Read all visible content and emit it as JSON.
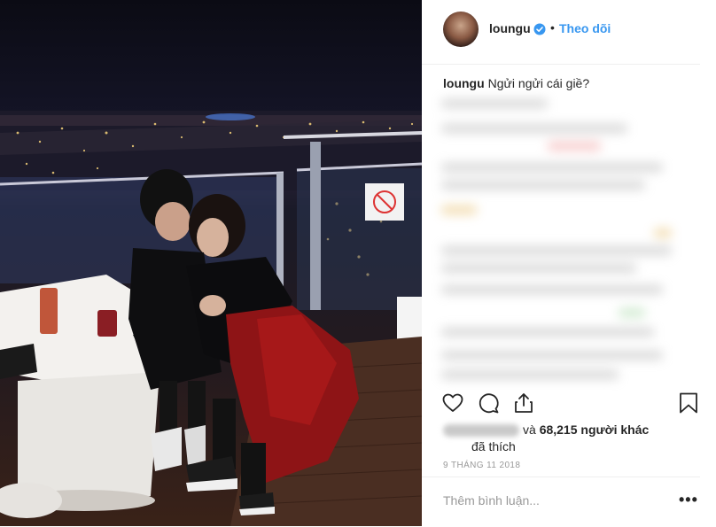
{
  "post": {
    "username": "loungu",
    "verified_icon": "verified-badge-icon",
    "separator": "•",
    "follow_label": "Theo dõi",
    "caption_user": "loungu",
    "caption_text": "Ngửi ngửi cái giề?",
    "likes_connector": "và",
    "likes_count": "68,215 người khác",
    "likes_suffix": "đã thích",
    "date": "9 THÁNG 11 2018",
    "comment_placeholder": "Thêm bình luận...",
    "more_label": "•••"
  },
  "icons": {
    "like": "heart-icon",
    "comment": "comment-icon",
    "share": "share-icon",
    "save": "bookmark-icon"
  },
  "photo_sign": {
    "text": "no-smoking-sign"
  },
  "colors": {
    "accent": "#3897f0",
    "text": "#262626",
    "muted": "#999999",
    "divider": "#efefef"
  }
}
